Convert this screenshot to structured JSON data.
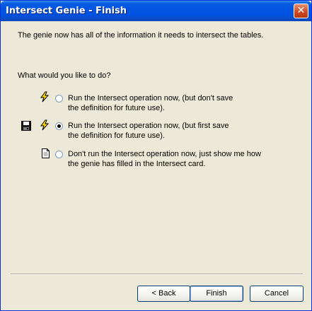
{
  "window": {
    "title": "Intersect Genie - Finish",
    "close_glyph": "✕"
  },
  "content": {
    "intro": "The genie now has all of the information it needs to intersect the tables.",
    "question": "What would you like to do?",
    "options": [
      {
        "line1": "Run the Intersect operation now, (but don't save",
        "line2": "the definition for future use).",
        "icons": [
          "lightning-icon"
        ],
        "selected": false
      },
      {
        "line1": "Run the Intersect operation now, (but first save",
        "line2": "the definition for future use).",
        "icons": [
          "save-disk-icon",
          "lightning-icon"
        ],
        "selected": true
      },
      {
        "line1": "Don't run the Intersect operation now, just show me how",
        "line2": "the genie has filled in the Intersect card.",
        "icons": [
          "document-icon"
        ],
        "selected": false
      }
    ]
  },
  "buttons": {
    "back": "< Back",
    "finish": "Finish",
    "cancel": "Cancel"
  },
  "colors": {
    "titlebar": "#0052df",
    "dialog_bg": "#ece9d8",
    "lightning_yellow": "#ffd800"
  }
}
